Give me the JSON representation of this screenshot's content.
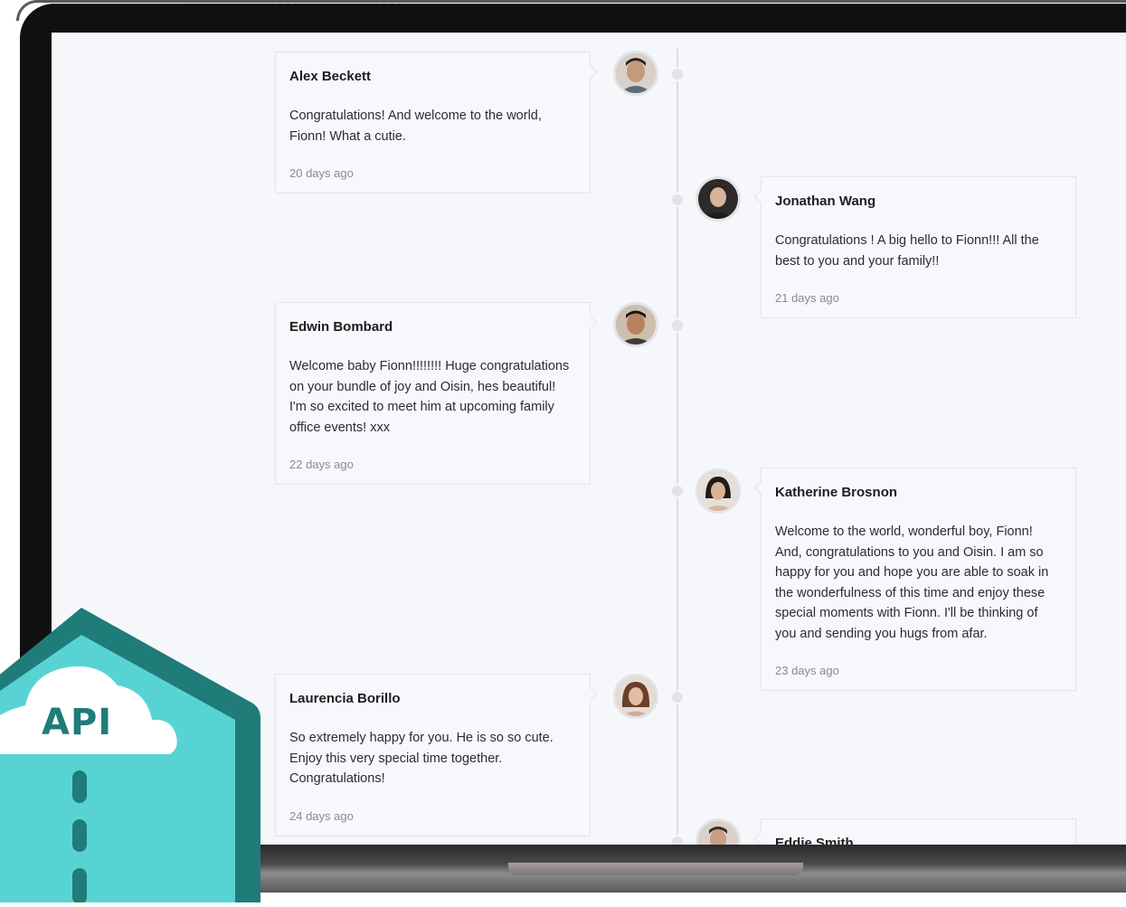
{
  "timeline": {
    "entries": [
      {
        "name": "Alex Beckett",
        "message": "Congratulations! And welcome to the world, Fionn! What a cutie.",
        "time": "20 days ago",
        "side": "left"
      },
      {
        "name": "Jonathan Wang",
        "message": "Congratulations ! A big hello to Fionn!!! All the best to you and your family!!",
        "time": "21 days ago",
        "side": "right"
      },
      {
        "name": "Edwin Bombard",
        "message": "Welcome baby Fionn!!!!!!!! Huge congratulations on your bundle of joy and Oisin, hes beautiful! I'm so excited to meet him at upcoming family office events! xxx",
        "time": "22 days ago",
        "side": "left"
      },
      {
        "name": "Katherine Brosnon",
        "message": "Welcome to the world, wonderful boy, Fionn! And, congratulations to you and Oisin. I am so happy for you and hope you are able to soak in the wonderfulness of this time and enjoy these special moments with Fionn. I'll be thinking of you and sending you hugs from afar.",
        "time": "23 days ago",
        "side": "right"
      },
      {
        "name": "Laurencia Borillo",
        "message": "So extremely happy for you. He is so so cute. Enjoy this very special time together. Congratulations!",
        "time": "24 days ago",
        "side": "left"
      },
      {
        "name": "Eddie Smith",
        "message": "",
        "time": "",
        "side": "right"
      }
    ]
  },
  "badge": {
    "label": "API",
    "icon": "cloud-api-icon"
  },
  "colors": {
    "badge_dark": "#1f7c78",
    "badge_light": "#58d3d3",
    "page_bg": "#f6f7fb"
  }
}
